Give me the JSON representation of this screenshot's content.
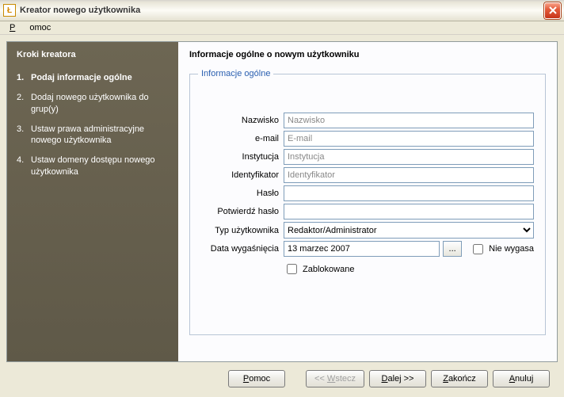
{
  "window": {
    "title": "Kreator nowego użytkownika"
  },
  "menu": {
    "help": "Pomoc"
  },
  "sidebar": {
    "heading": "Kroki kreatora",
    "steps": [
      {
        "num": "1.",
        "label": "Podaj informacje ogólne"
      },
      {
        "num": "2.",
        "label": "Dodaj nowego użytkownika do grup(y)"
      },
      {
        "num": "3.",
        "label": "Ustaw prawa administracyjne nowego użytkownika"
      },
      {
        "num": "4.",
        "label": "Ustaw domeny dostępu nowego użytkownika"
      }
    ]
  },
  "main": {
    "heading": "Informacje ogólne o nowym użytkowniku",
    "group_legend": "Informacje ogólne",
    "labels": {
      "nazwisko": "Nazwisko",
      "email": "e-mail",
      "instytucja": "Instytucja",
      "identyfikator": "Identyfikator",
      "haslo": "Hasło",
      "potwierdz": "Potwierdź hasło",
      "typ": "Typ użytkownika",
      "data": "Data wygaśnięcia"
    },
    "placeholders": {
      "nazwisko": "Nazwisko",
      "email": "E-mail",
      "instytucja": "Instytucja",
      "identyfikator": "Identyfikator"
    },
    "typ_value": "Redaktor/Administrator",
    "data_value": "13 marzec 2007",
    "dots": "...",
    "nie_wygasa": "Nie wygasa",
    "zablokowane": "Zablokowane"
  },
  "buttons": {
    "pomoc": "Pomoc",
    "wstecz": "<< Wstecz",
    "dalej": "Dalej >>",
    "zakoncz": "Zakończ",
    "anuluj": "Anuluj"
  }
}
